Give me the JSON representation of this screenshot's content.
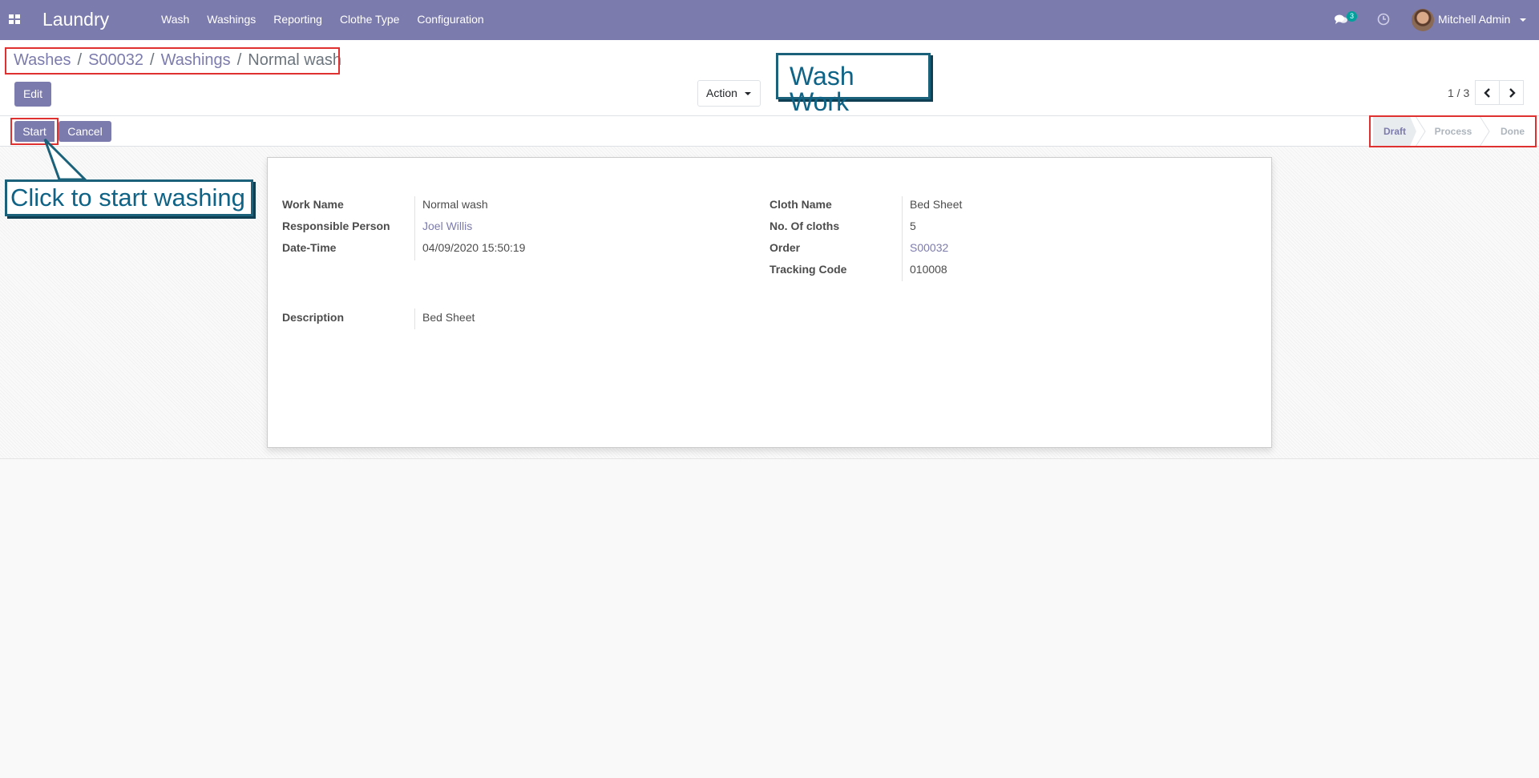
{
  "navbar": {
    "brand": "Laundry",
    "menu": [
      "Wash",
      "Washings",
      "Reporting",
      "Clothe Type",
      "Configuration"
    ],
    "chat_count": "3",
    "user_name": "Mitchell Admin"
  },
  "breadcrumb": [
    "Washes",
    "S00032",
    "Washings",
    "Normal wash"
  ],
  "control": {
    "edit_label": "Edit",
    "action_label": "Action",
    "pager": "1 / 3"
  },
  "statusbar": {
    "start_label": "Start",
    "cancel_label": "Cancel",
    "stages": [
      "Draft",
      "Process",
      "Done"
    ],
    "current_stage": "Draft"
  },
  "form": {
    "left": [
      {
        "label": "Work Name",
        "value": "Normal wash"
      },
      {
        "label": "Responsible Person",
        "value": "Joel Willis"
      },
      {
        "label": "Date-Time",
        "value": "04/09/2020 15:50:19"
      }
    ],
    "right": [
      {
        "label": "Cloth Name",
        "value": "Bed Sheet"
      },
      {
        "label": "No. Of cloths",
        "value": "5"
      },
      {
        "label": "Order",
        "value": "S00032"
      },
      {
        "label": "Tracking Code",
        "value": "010008"
      }
    ],
    "description": {
      "label": "Description",
      "value": "Bed Sheet"
    }
  },
  "annotations": {
    "title_callout": "Wash Work",
    "start_callout": "Click to start washing"
  },
  "colors": {
    "brand": "#7c7bad",
    "link": "#7c7bad",
    "callout_text": "#0e6386",
    "highlight": "#e03131"
  }
}
